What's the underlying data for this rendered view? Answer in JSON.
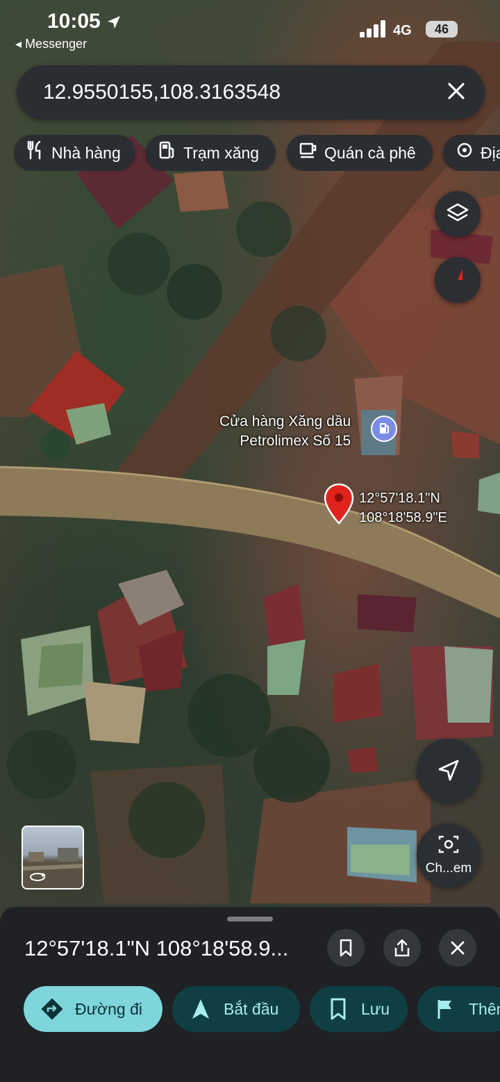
{
  "status_bar": {
    "time": "10:05",
    "back_app": "Messenger",
    "network": "4G",
    "battery": "46"
  },
  "search": {
    "query": "12.9550155,108.3163548"
  },
  "chips": [
    {
      "label": "Nhà hàng",
      "icon": "restaurant-icon"
    },
    {
      "label": "Trạm xăng",
      "icon": "gas-station-icon"
    },
    {
      "label": "Quán cà phê",
      "icon": "coffee-icon"
    },
    {
      "label": "Địa",
      "icon": "landmark-icon"
    }
  ],
  "map": {
    "poi_name_line1": "Cửa hàng Xăng dầu",
    "poi_name_line2": "Petrolimex Số 15",
    "pin_lat": "12°57'18.1\"N",
    "pin_lng": "108°18'58.9\"E",
    "street_view_button_label": "Ch...em"
  },
  "sheet": {
    "coords": "12°57'18.1\"N 108°18'58.9...",
    "actions": [
      {
        "label": "Đường đi",
        "icon": "directions-icon"
      },
      {
        "label": "Bắt đầu",
        "icon": "navigation-arrow-icon"
      },
      {
        "label": "Lưu",
        "icon": "bookmark-icon"
      },
      {
        "label": "Thêm",
        "icon": "flag-icon"
      }
    ]
  },
  "colors": {
    "primary_action": "#7fd5dc",
    "secondary_action": "#0f3f42",
    "pin": "#e0231c",
    "poi": "#7b8ce8"
  }
}
